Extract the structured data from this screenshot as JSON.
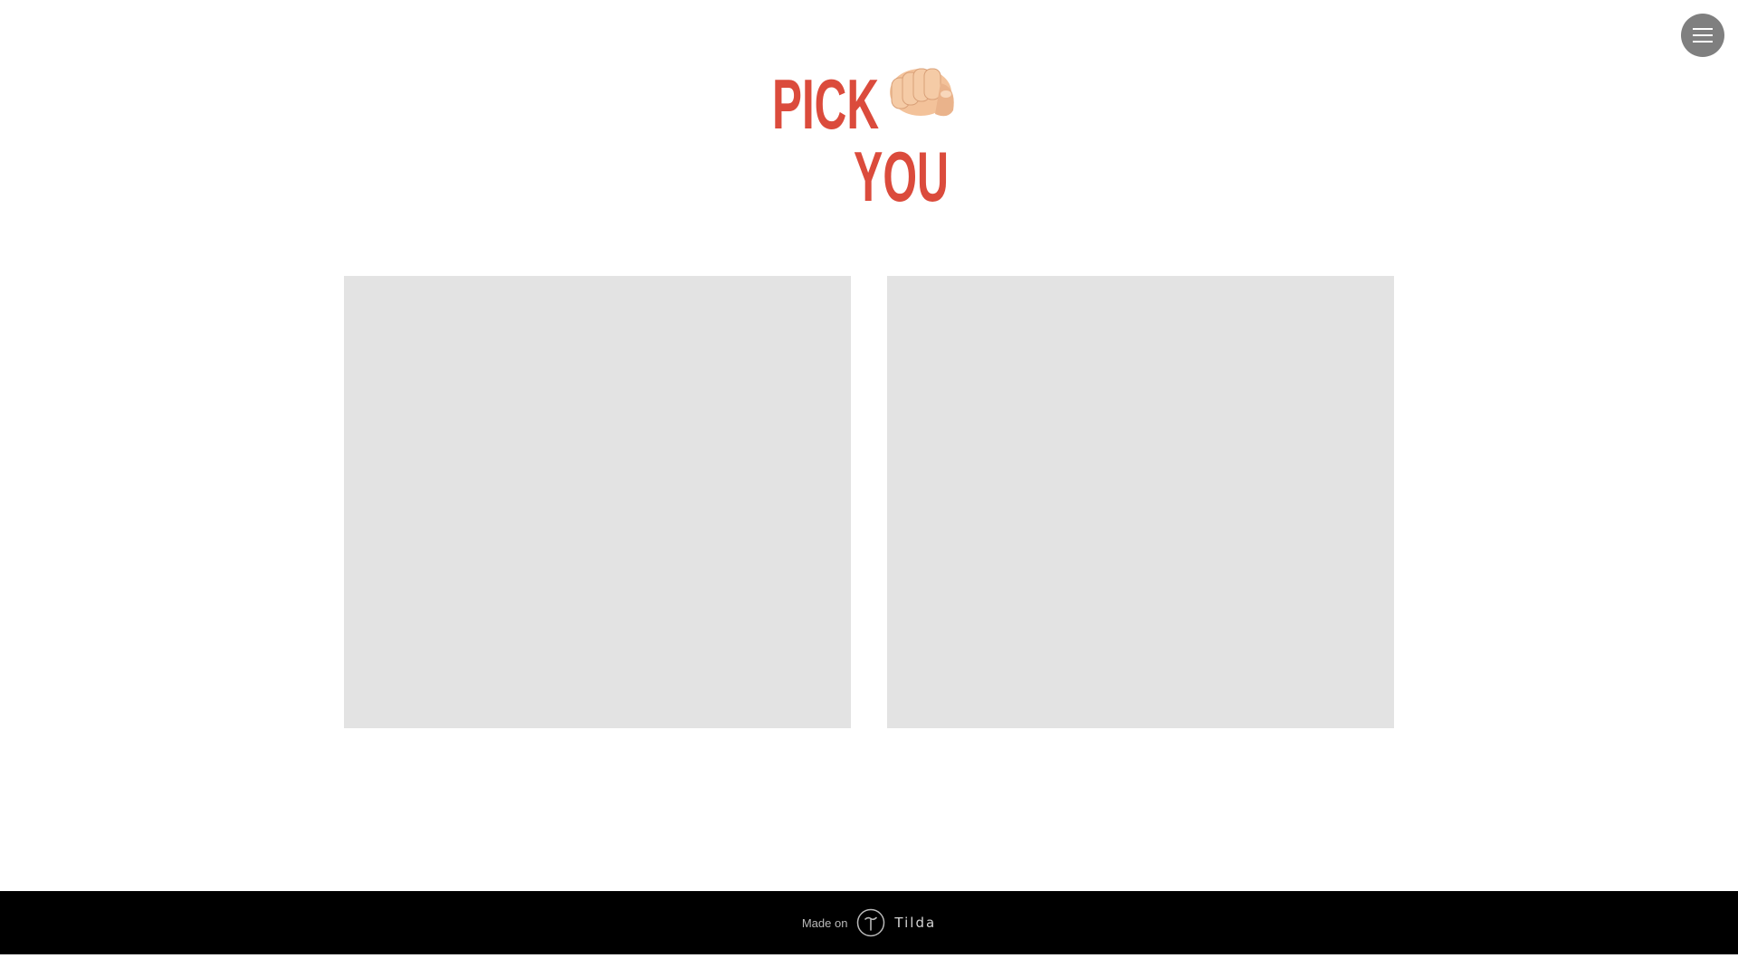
{
  "header": {
    "menu_icon": "hamburger-menu-icon",
    "logo": {
      "line1": "PICK",
      "line2": "YOU",
      "hand_icon": "pointing-hand-icon",
      "brand_color": "#db4b3c"
    }
  },
  "main": {
    "cards": [
      {
        "placeholder_color": "#e3e3e3"
      },
      {
        "placeholder_color": "#e3e3e3"
      }
    ]
  },
  "footer": {
    "made_on_label": "Made on",
    "platform_name": "Tilda",
    "platform_icon": "tilda-logo-icon",
    "background": "#000000"
  }
}
